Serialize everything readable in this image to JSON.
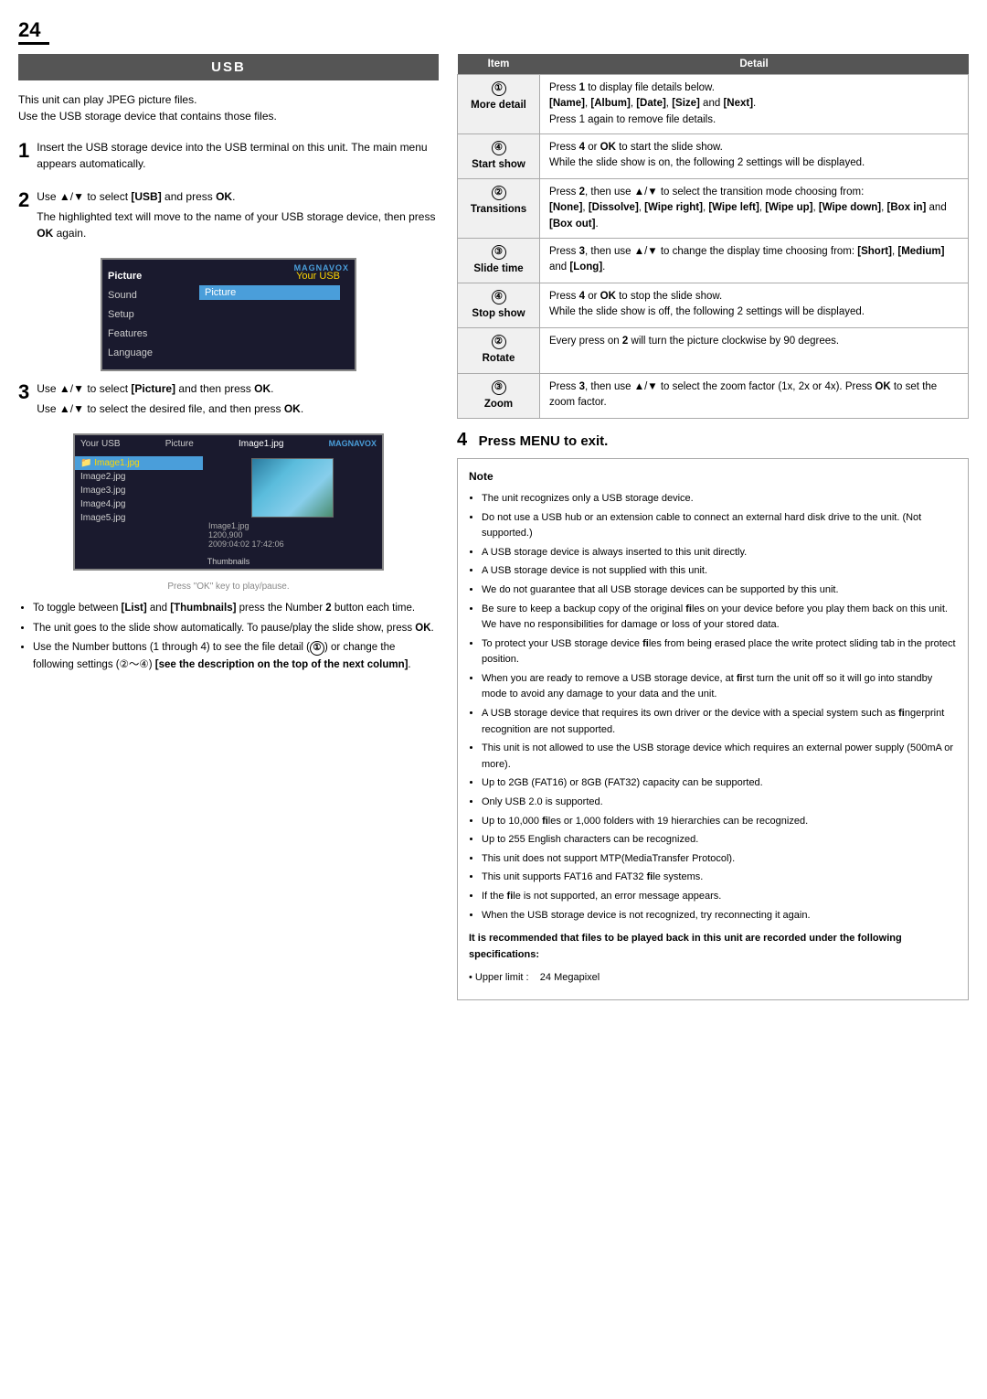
{
  "page": {
    "number": "24",
    "section_title": "USB"
  },
  "intro": {
    "line1": "This unit can play JPEG picture files.",
    "line2": "Use the USB storage device that contains those files."
  },
  "steps": [
    {
      "number": "1",
      "text": "Insert the USB storage device into the USB terminal on this unit. The main menu appears automatically."
    },
    {
      "number": "2",
      "text1": "Use ▲/▼ to select [USB] and press OK.",
      "text2": "The highlighted text will move to the name of your USB storage device, then press OK again."
    },
    {
      "number": "3",
      "text1": "Use ▲/▼ to select [Picture] and then press OK.",
      "text2": "Use ▲/▼ to select the desired file, and then press OK."
    }
  ],
  "tv_menu": {
    "brand": "MAGNAVOX",
    "usb_label": "Your USB",
    "menu_items": [
      "Picture",
      "Sound",
      "Setup",
      "Features",
      "Language"
    ],
    "highlighted": "Picture"
  },
  "file_browser": {
    "brand": "MAGNAVOX",
    "path1": "Your USB",
    "path2": "Picture",
    "path3": "Image1.jpg",
    "files": [
      {
        "name": "Image1.jpg",
        "active": true,
        "folder": true
      },
      {
        "name": "Image2.jpg",
        "active": false
      },
      {
        "name": "Image3.jpg",
        "active": false
      },
      {
        "name": "Image4.jpg",
        "active": false
      },
      {
        "name": "Image5.jpg",
        "active": false
      }
    ],
    "preview_info1": "Image1.jpg",
    "preview_info2": "1200,900",
    "preview_info3": "2009:04:02 17:42:06",
    "footer": "Thumbnails",
    "footer2": "Press \"OK\" key to play/pause."
  },
  "bullet_points": [
    "To toggle between [List] and [Thumbnails] press the Number 2 button each time.",
    "The unit goes to the slide show automatically. To pause/play the slide show, press OK.",
    "Use the Number buttons (1 through 4) to see the file detail (①) or change the following settings (②～④) [see the description on the top of the next column]."
  ],
  "table": {
    "headers": [
      "Item",
      "Detail"
    ],
    "rows": [
      {
        "circle": "①",
        "item": "More detail",
        "detail": "Press 1 to display file details below.\n[Name], [Album], [Date], [Size] and [Next].\nPress 1 again to remove file details."
      },
      {
        "circle": "④",
        "item": "Start show",
        "detail": "Press 4 or OK to start the slide show.\nWhile the slide show is on, the following 2 settings will be displayed."
      },
      {
        "circle": "②",
        "item": "Transitions",
        "detail": "Press 2, then use ▲/▼ to select the transition mode choosing from:\n[None], [Dissolve], [Wipe right], [Wipe left], [Wipe up], [Wipe down], [Box in] and [Box out]."
      },
      {
        "circle": "③",
        "item": "Slide time",
        "detail": "Press 3, then use ▲/▼ to change the display time choosing from: [Short], [Medium] and [Long]."
      },
      {
        "circle": "④",
        "item": "Stop show",
        "detail": "Press 4 or OK to stop the slide show.\nWhile the slide show is off, the following 2 settings will be displayed."
      },
      {
        "circle": "②",
        "item": "Rotate",
        "detail": "Every press on 2 will turn the picture clockwise by 90 degrees."
      },
      {
        "circle": "③",
        "item": "Zoom",
        "detail": "Press 3, then use ▲/▼ to select the zoom factor (1x, 2x or 4x). Press OK to set the zoom factor."
      }
    ]
  },
  "step4": {
    "number": "4",
    "text": "Press MENU to exit."
  },
  "note": {
    "title": "Note",
    "items": [
      "The unit recognizes only a USB storage device.",
      "Do not use a USB hub or an extension cable to connect an external hard disk drive to the unit. (Not supported.)",
      "A USB storage device is always inserted to this unit directly.",
      "A USB storage device is not supplied with this unit.",
      "We do not guarantee that all USB storage devices can be supported by this unit.",
      "Be sure to keep a backup copy of the original files on your device before you play them back on this unit. We have no responsibilities for damage or loss of your stored data.",
      "To protect your USB storage device files from being erased place the write protect sliding tab in the protect position.",
      "When you are ready to remove a USB storage device, at first turn the unit off so it will go into standby mode to avoid any damage to your data and the unit.",
      "A USB storage device that requires its own driver or the device with a special system such as fingerprint recognition are not supported.",
      "This unit is not allowed to use the USB storage device which requires an external power supply (500mA or more).",
      "Up to 2GB (FAT16) or 8GB (FAT32) capacity can be supported.",
      "Only USB 2.0 is supported.",
      "Up to 10,000 files or 1,000 folders with 19 hierarchies can be recognized.",
      "Up to 255 English characters can be recognized.",
      "This unit does not support MTP(MediaTransfer Protocol).",
      "This unit supports FAT16 and FAT32 file systems.",
      "If the file is not supported, an error message appears.",
      "When the USB storage device is not recognized, try reconnecting it again."
    ],
    "bold_text": "It is recommended that files to be played back in this unit are recorded under the following specifications:",
    "spec": "• Upper limit :     24 Megapixel"
  }
}
